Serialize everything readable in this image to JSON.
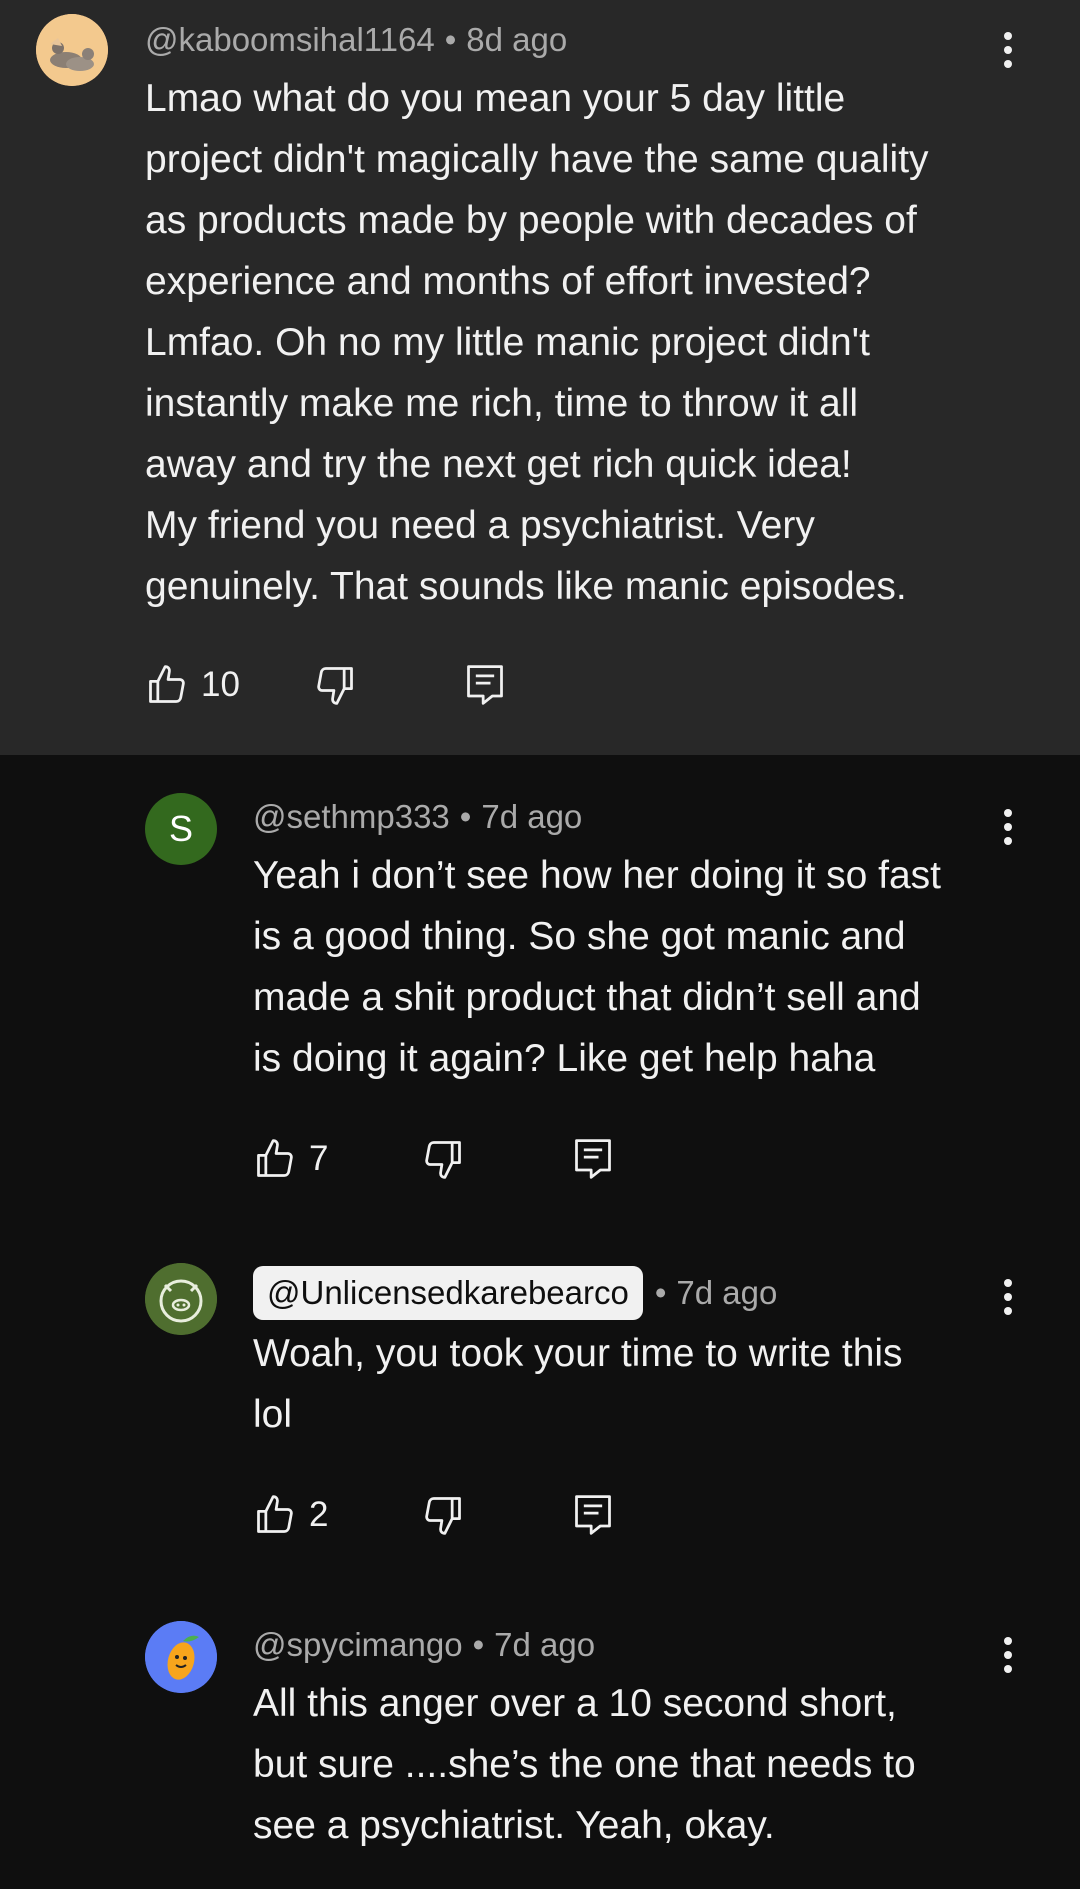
{
  "comments": [
    {
      "handle": "@kaboomsihal1164",
      "time": "8d ago",
      "body": "Lmao what do you mean your 5 day little\nproject didn't magically have the same quality\nas products made by people with decades of\nexperience and months of effort invested?\nLmfao. Oh no my little manic project didn't\ninstantly make me rich, time to throw it all\naway and try the next get rich quick idea!\nMy friend you need a psychiatrist. Very\ngenuinely. That sounds like manic episodes.",
      "likes": "10",
      "avatar_icon": "pigeon-avatar",
      "highlighted": true
    },
    {
      "handle": "@sethmp333",
      "time": "7d ago",
      "body": "Yeah i don’t see how her doing it so fast\nis a good thing. So she got manic and\nmade a shit product that didn’t sell and\nis doing it again? Like get help haha",
      "likes": "7",
      "avatar_letter": "S",
      "avatar_color": "#33691e"
    },
    {
      "handle": "@Unlicensedkarebearco",
      "time": "7d ago",
      "body": "Woah, you took your time to write this\nlol",
      "likes": "2",
      "avatar_icon": "pig-avatar",
      "handle_highlighted": true
    },
    {
      "handle": "@spycimango",
      "time": "7d ago",
      "body": "All this anger over a 10 second short,\nbut sure ....she’s the one that needs to\nsee a psychiatrist. Yeah, okay.",
      "avatar_icon": "mango-avatar",
      "avatar_color": "#5b7cf5"
    }
  ],
  "separator": " • ",
  "colors": {
    "background": "#0f0f0f",
    "highlight_background": "#282828",
    "meta_text": "#aaaaaa",
    "body_text": "#f1f1f1"
  }
}
